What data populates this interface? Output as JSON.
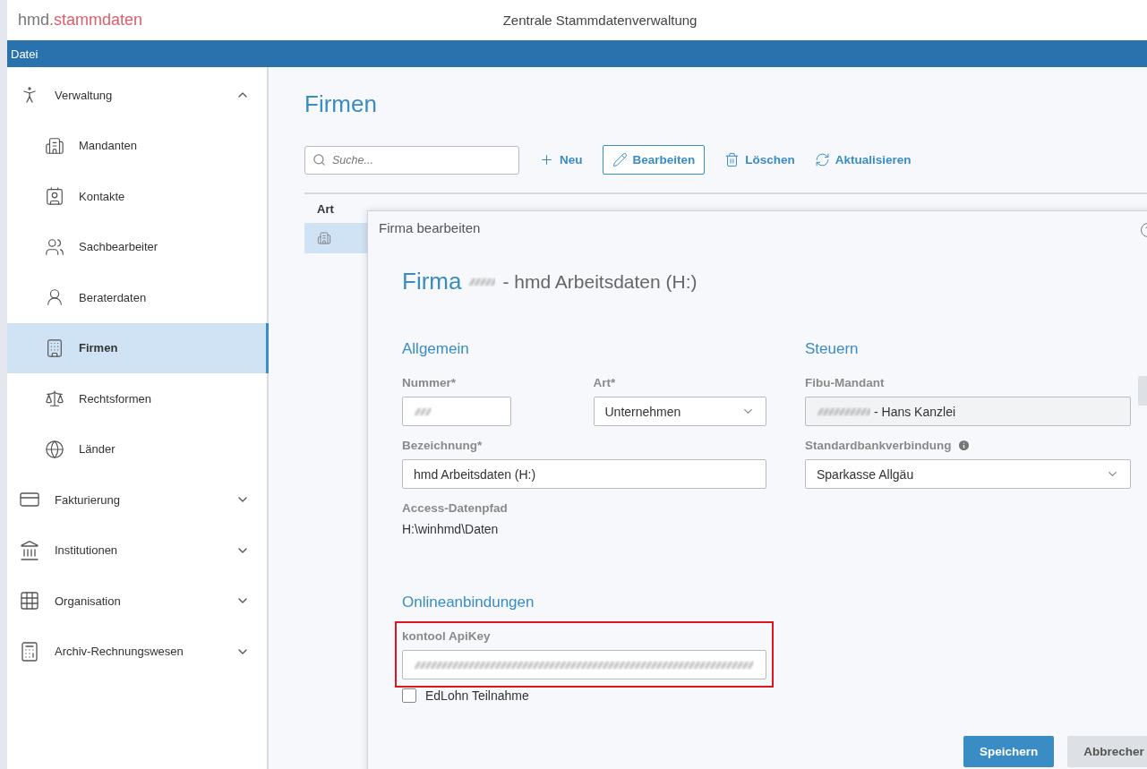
{
  "window": {
    "brand": "hmd",
    "brand_suffix": ".stammdaten",
    "title": "Zentrale Stammdatenverwaltung"
  },
  "menu": [
    "Datei"
  ],
  "sidebar": {
    "items": [
      {
        "label": "Verwaltung",
        "expanded": true,
        "children": [
          {
            "label": "Mandanten",
            "selected": false
          },
          {
            "label": "Kontakte",
            "selected": false
          },
          {
            "label": "Sachbearbeiter",
            "selected": false
          },
          {
            "label": "Beraterdaten",
            "selected": false
          },
          {
            "label": "Firmen",
            "selected": true
          },
          {
            "label": "Rechtsformen",
            "selected": false
          },
          {
            "label": "Länder",
            "selected": false
          }
        ]
      },
      {
        "label": "Fakturierung",
        "expanded": false
      },
      {
        "label": "Institutionen",
        "expanded": false
      },
      {
        "label": "Organisation",
        "expanded": false
      },
      {
        "label": "Archiv-Rechnungswesen",
        "expanded": false
      }
    ]
  },
  "page": {
    "title": "Firmen",
    "search": {
      "placeholder": "Suche..."
    },
    "toolbar": [
      {
        "kind": "add",
        "label": "Neu",
        "selected": false
      },
      {
        "kind": "edit",
        "label": "Bearbeiten",
        "selected": true
      },
      {
        "kind": "delete",
        "label": "Löschen",
        "selected": false
      },
      {
        "kind": "refresh",
        "label": "Aktualisieren",
        "selected": false
      }
    ],
    "table": {
      "columns": [
        "Art"
      ],
      "rows": [
        {
          "selected": true
        }
      ]
    }
  },
  "dialog": {
    "title": "Firma bearbeiten",
    "heading": {
      "label": "Firma",
      "number_redacted": true,
      "name": "- hmd Arbeitsdaten (H:)"
    },
    "left": [
      {
        "heading": "Allgemein",
        "rows": [
          [
            {
              "kind": "text",
              "label": "Nummer*",
              "redacted": true
            },
            {
              "kind": "select",
              "label": "Art*",
              "value": "Unternehmen"
            }
          ],
          [
            {
              "kind": "text",
              "label": "Bezeichnung*",
              "value": "hmd Arbeitsdaten (H:)"
            }
          ],
          [
            {
              "kind": "static",
              "label": "Access-Datenpfad",
              "value": "H:\\winhmd\\Daten"
            }
          ]
        ]
      },
      {
        "heading": "Onlineanbindungen",
        "rows": [
          [
            {
              "kind": "text",
              "label": "kontool ApiKey",
              "redacted": true,
              "highlighted": true
            }
          ],
          [
            {
              "kind": "checkbox",
              "label": "EdLohn Teilnahme",
              "checked": false
            }
          ]
        ]
      }
    ],
    "right": [
      {
        "heading": "Steuern",
        "rows": [
          [
            {
              "kind": "readonly",
              "label": "Fibu-Mandant",
              "redacted": true,
              "value": "- Hans Kanzlei"
            }
          ],
          [
            {
              "kind": "select",
              "label": "Standardbankverbindung",
              "info": true,
              "value": "Sparkasse Allgäu"
            }
          ]
        ]
      }
    ],
    "buttons": [
      {
        "kind": "primary",
        "label": "Speichern"
      },
      {
        "kind": "secondary",
        "label": "Abbrecher"
      }
    ]
  }
}
